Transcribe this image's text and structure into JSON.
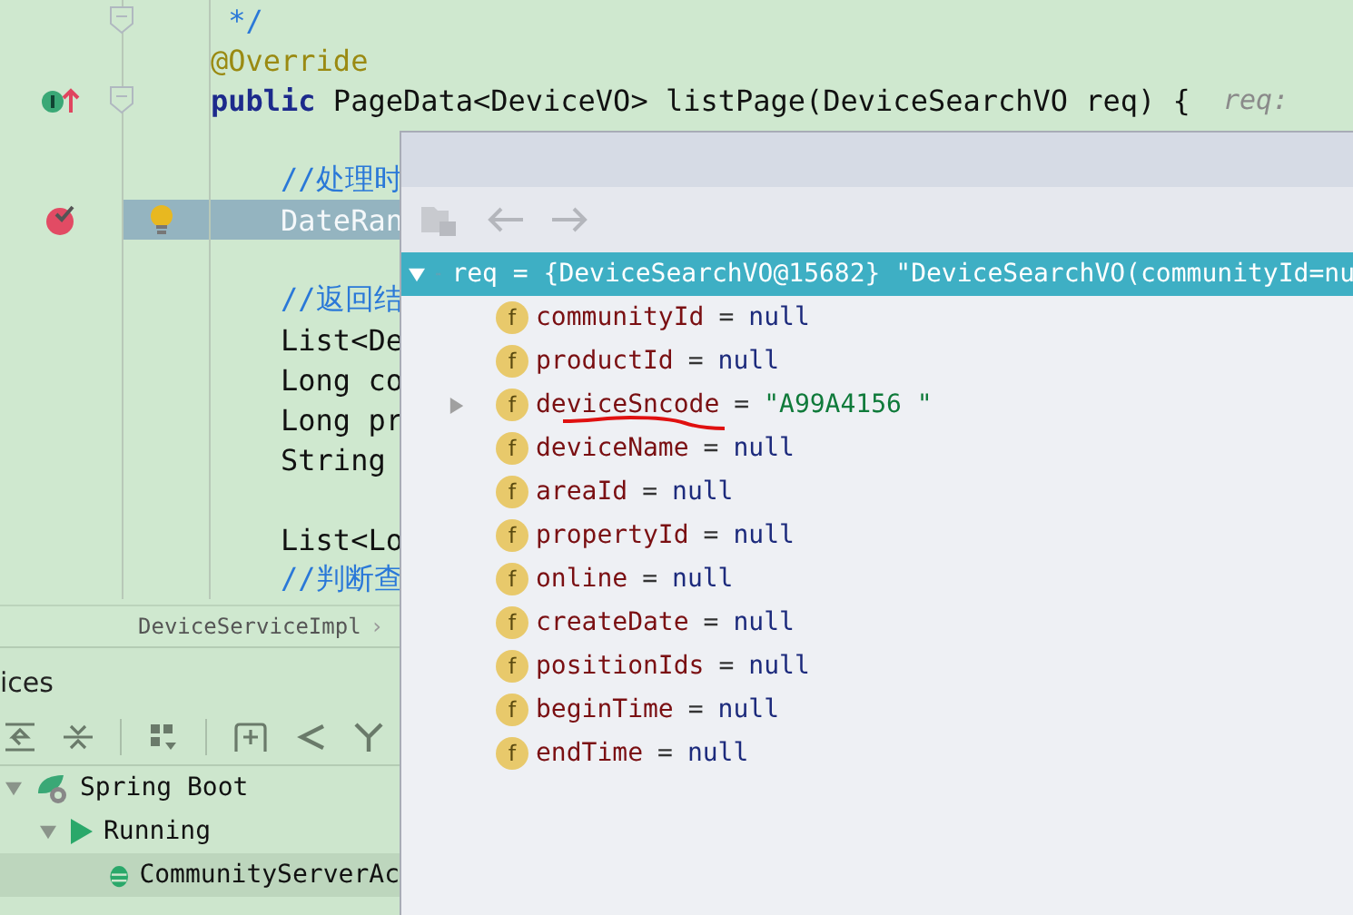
{
  "editor": {
    "lines": [
      {
        "kind": "code",
        "fold": true,
        "highlighted": false,
        "tokens": [
          {
            "kind": "comment",
            "text": " */"
          }
        ]
      },
      {
        "kind": "code",
        "fold": false,
        "highlighted": false,
        "tokens": [
          {
            "kind": "annotation",
            "text": "@Override"
          }
        ]
      },
      {
        "kind": "code",
        "fold": true,
        "highlighted": false,
        "icons": [
          {
            "kind": "implements"
          }
        ],
        "tokens": [
          {
            "kind": "keyword",
            "text": "public"
          },
          {
            "kind": "plain",
            "text": " PageData<DeviceVO> listPage(DeviceSearchVO req) {"
          },
          {
            "kind": "hint",
            "text": "  req:"
          }
        ]
      },
      {
        "kind": "blank"
      },
      {
        "kind": "code",
        "fold": false,
        "highlighted": false,
        "tokens": [
          {
            "kind": "comment",
            "text": "    //处理时"
          }
        ]
      },
      {
        "kind": "code",
        "fold": false,
        "highlighted": true,
        "icons": [
          {
            "kind": "breakpoint"
          },
          {
            "kind": "bulb"
          }
        ],
        "tokens": [
          {
            "kind": "plain",
            "text": "    DateRan"
          }
        ]
      },
      {
        "kind": "blank"
      },
      {
        "kind": "code",
        "fold": false,
        "highlighted": false,
        "tokens": [
          {
            "kind": "comment",
            "text": "    //返回结"
          }
        ]
      },
      {
        "kind": "code",
        "fold": false,
        "highlighted": false,
        "tokens": [
          {
            "kind": "plain",
            "text": "    List<De"
          }
        ]
      },
      {
        "kind": "code",
        "fold": false,
        "highlighted": false,
        "tokens": [
          {
            "kind": "plain",
            "text": "    Long co"
          }
        ]
      },
      {
        "kind": "code",
        "fold": false,
        "highlighted": false,
        "tokens": [
          {
            "kind": "plain",
            "text": "    Long pr"
          }
        ]
      },
      {
        "kind": "code",
        "fold": false,
        "highlighted": false,
        "tokens": [
          {
            "kind": "plain",
            "text": "    String"
          }
        ]
      },
      {
        "kind": "blank"
      },
      {
        "kind": "code",
        "fold": false,
        "highlighted": false,
        "tokens": [
          {
            "kind": "plain",
            "text": "    List<Lo"
          }
        ]
      },
      {
        "kind": "code",
        "fold": false,
        "highlighted": false,
        "tokens": [
          {
            "kind": "comment",
            "text": "    //判断查"
          }
        ]
      }
    ],
    "breadcrumb": "DeviceServiceImpl",
    "breadcrumb_arrow": "›"
  },
  "services": {
    "title": "ices",
    "tree": [
      {
        "label": "Spring Boot",
        "kind": "springboot",
        "expanded": true,
        "selected": false,
        "children": [
          {
            "label": "Running",
            "kind": "running",
            "expanded": true,
            "selected": false,
            "children": [
              {
                "label": "CommunityServerAc",
                "kind": "app",
                "selected": true
              }
            ]
          }
        ]
      }
    ]
  },
  "debugger": {
    "root": {
      "label": "req = {DeviceSearchVO@15682} \"DeviceSearchVO(communityId=nu",
      "expanded": true,
      "selected": true
    },
    "fields": [
      {
        "icon": "f",
        "name": "communityId",
        "operator": "=",
        "value": "null",
        "kind": "null",
        "expandable": false,
        "marked": false
      },
      {
        "icon": "f",
        "name": "productId",
        "operator": "=",
        "value": "null",
        "kind": "null",
        "expandable": false,
        "marked": false
      },
      {
        "icon": "f",
        "name": "deviceSncode",
        "operator": "=",
        "value": "\"A99A4156 \"",
        "kind": "string",
        "expandable": true,
        "marked": true
      },
      {
        "icon": "f",
        "name": "deviceName",
        "operator": "=",
        "value": "null",
        "kind": "null",
        "expandable": false,
        "marked": false
      },
      {
        "icon": "f",
        "name": "areaId",
        "operator": "=",
        "value": "null",
        "kind": "null",
        "expandable": false,
        "marked": false
      },
      {
        "icon": "f",
        "name": "propertyId",
        "operator": "=",
        "value": "null",
        "kind": "null",
        "expandable": false,
        "marked": false
      },
      {
        "icon": "f",
        "name": "online",
        "operator": "=",
        "value": "null",
        "kind": "null",
        "expandable": false,
        "marked": false
      },
      {
        "icon": "f",
        "name": "createDate",
        "operator": "=",
        "value": "null",
        "kind": "null",
        "expandable": false,
        "marked": false
      },
      {
        "icon": "f",
        "name": "positionIds",
        "operator": "=",
        "value": "null",
        "kind": "null",
        "expandable": false,
        "marked": false
      },
      {
        "icon": "f",
        "name": "beginTime",
        "operator": "=",
        "value": "null",
        "kind": "null",
        "expandable": false,
        "marked": false
      },
      {
        "icon": "f",
        "name": "endTime",
        "operator": "=",
        "value": "null",
        "kind": "null",
        "expandable": false,
        "marked": false
      }
    ]
  }
}
